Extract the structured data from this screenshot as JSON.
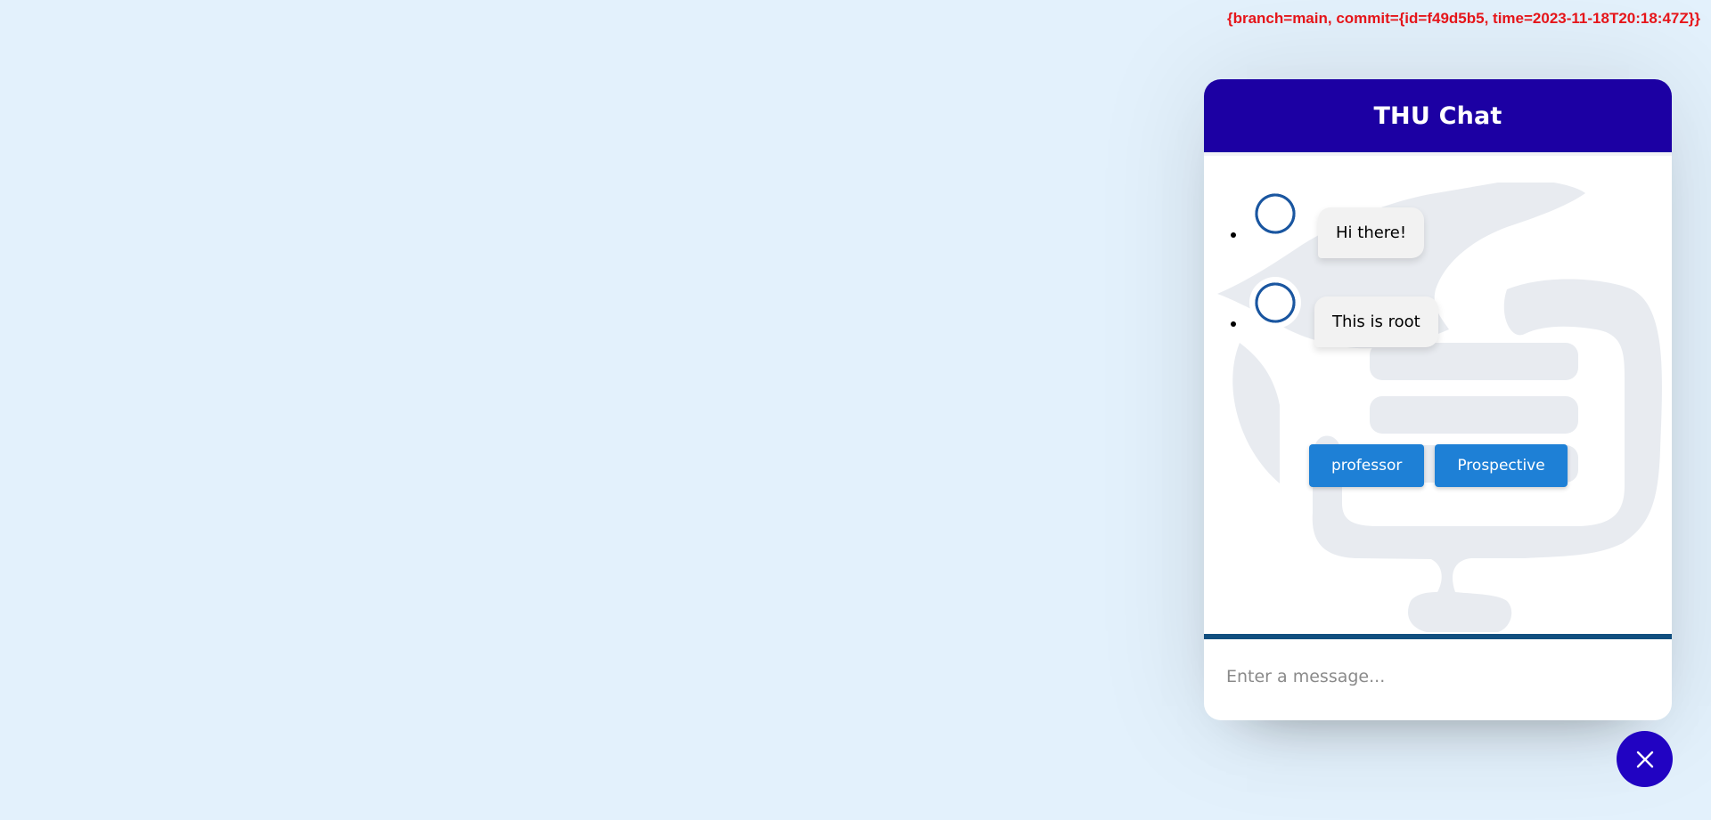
{
  "build_info": "{branch=main, commit={id=f49d5b5, time=2023-11-18T20:18:47Z}}",
  "chat": {
    "title": "THU Chat",
    "messages": [
      {
        "text": "Hi there!"
      },
      {
        "text": "This is root"
      }
    ],
    "options": [
      {
        "label": "professor"
      },
      {
        "label": "Prospective"
      }
    ],
    "input": {
      "placeholder": "Enter a message...",
      "value": ""
    }
  },
  "icons": {
    "avatar": "spiral-logo-icon",
    "watermark": "university-emblem-icon",
    "toggle": "close-icon"
  },
  "colors": {
    "page_background": "#e3f1fc",
    "header": "#1c00a3",
    "option_button": "#1e80d6",
    "input_divider": "#114f7f",
    "toggle_button": "#2103c2",
    "build_info": "#e8161b"
  }
}
